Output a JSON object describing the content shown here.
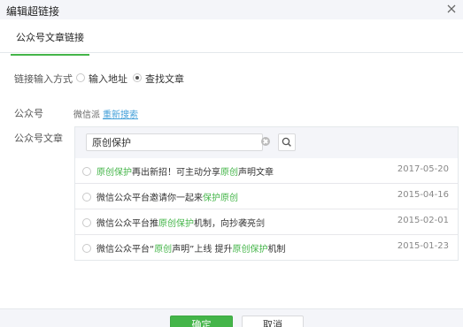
{
  "dialog": {
    "title": "编辑超链接"
  },
  "tabs": [
    {
      "label": "公众号文章链接"
    }
  ],
  "form": {
    "link_input_label": "链接输入方式",
    "options": [
      {
        "label": "输入地址",
        "checked": false
      },
      {
        "label": "查找文章",
        "checked": true
      }
    ],
    "account_label": "公众号",
    "account_name": "微信派",
    "research_link": "重新搜索",
    "article_label": "公众号文章"
  },
  "search": {
    "value": "原创保护"
  },
  "articles": [
    {
      "parts": [
        {
          "t": "原创保护",
          "hl": true
        },
        {
          "t": "再出新招！可主动分享",
          "hl": false
        },
        {
          "t": "原创",
          "hl": true
        },
        {
          "t": "声明文章",
          "hl": false
        }
      ],
      "date": "2017-05-20"
    },
    {
      "parts": [
        {
          "t": "微信公众平台邀请你一起来",
          "hl": false
        },
        {
          "t": "保护原创",
          "hl": true
        }
      ],
      "date": "2015-04-16"
    },
    {
      "parts": [
        {
          "t": "微信公众平台推",
          "hl": false
        },
        {
          "t": "原创保护",
          "hl": true
        },
        {
          "t": "机制，向抄袭亮剑",
          "hl": false
        }
      ],
      "date": "2015-02-01"
    },
    {
      "parts": [
        {
          "t": "微信公众平台“",
          "hl": false
        },
        {
          "t": "原创",
          "hl": true
        },
        {
          "t": "声明”上线 提升",
          "hl": false
        },
        {
          "t": "原创保护",
          "hl": true
        },
        {
          "t": "机制",
          "hl": false
        }
      ],
      "date": "2015-01-23"
    }
  ],
  "footer": {
    "confirm_label": "确定",
    "cancel_label": "取消"
  },
  "colors": {
    "accent": "#44b549",
    "link": "#44a0d9"
  }
}
